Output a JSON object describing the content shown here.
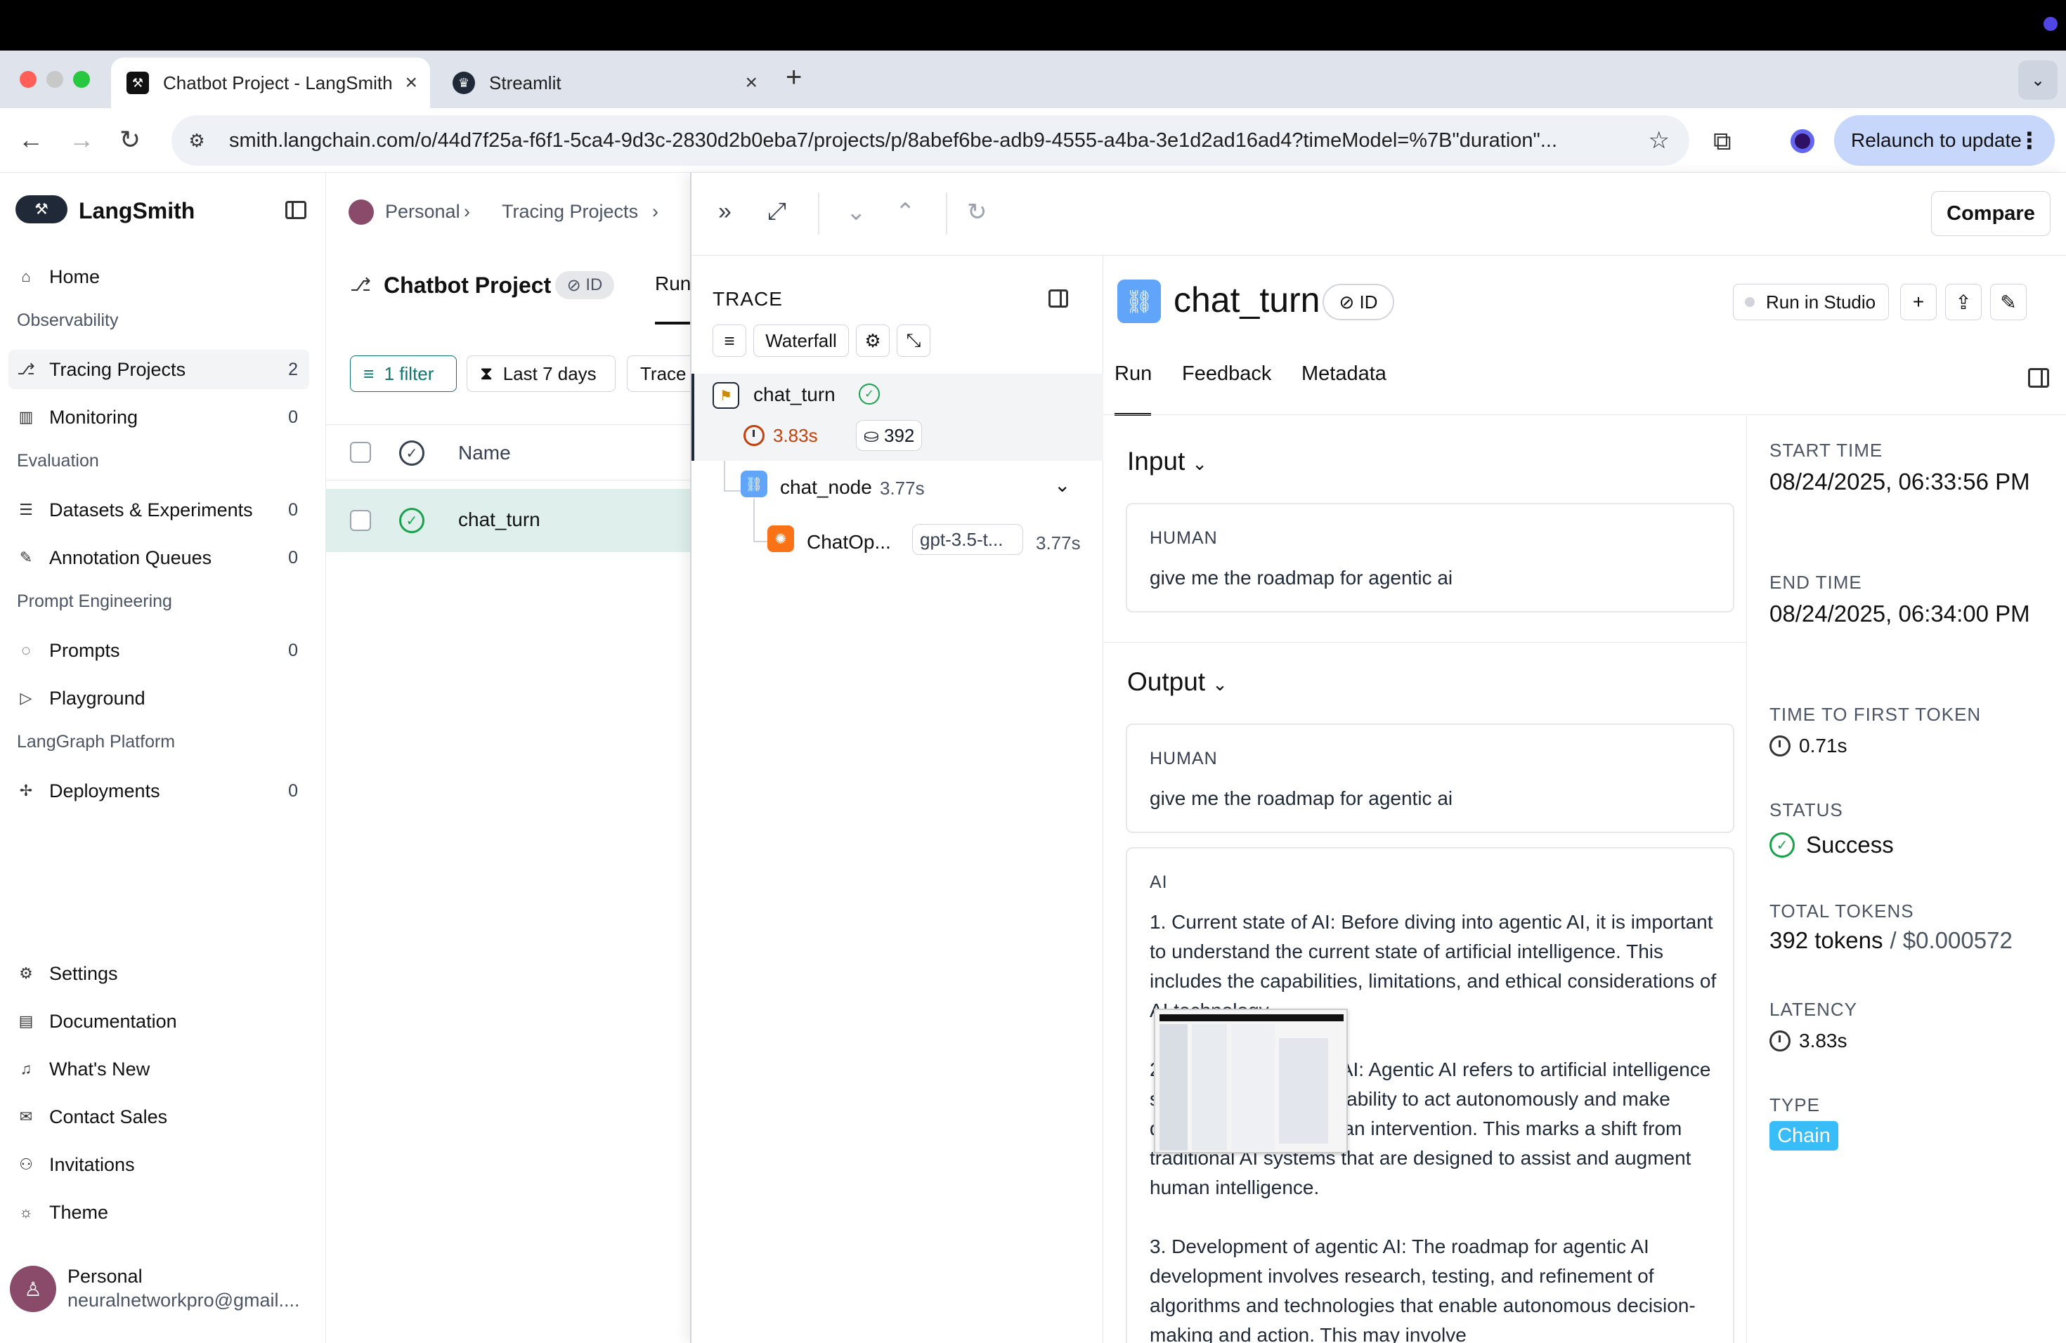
{
  "browser": {
    "tabs": [
      {
        "title": "Chatbot Project - LangSmith",
        "active": true
      },
      {
        "title": "Streamlit",
        "active": false
      }
    ],
    "url": "smith.langchain.com/o/44d7f25a-f6f1-5ca4-9d3c-2830d2b0eba7/projects/p/8abef6be-adb9-4555-a4ba-3e1d2ad16ad4?timeModel=%7B\"duration\"...",
    "relaunch_label": "Relaunch to update"
  },
  "sidebar": {
    "brand": "LangSmith",
    "home": "Home",
    "sections": {
      "observability": "Observability",
      "evaluation": "Evaluation",
      "prompt_engineering": "Prompt Engineering",
      "langgraph": "LangGraph Platform"
    },
    "items": {
      "tracing": {
        "label": "Tracing Projects",
        "count": "2"
      },
      "monitoring": {
        "label": "Monitoring",
        "count": "0"
      },
      "datasets": {
        "label": "Datasets & Experiments",
        "count": "0"
      },
      "annotation": {
        "label": "Annotation Queues",
        "count": "0"
      },
      "prompts": {
        "label": "Prompts",
        "count": "0"
      },
      "playground": {
        "label": "Playground"
      },
      "deployments": {
        "label": "Deployments",
        "count": "0"
      }
    },
    "bottom": {
      "settings": "Settings",
      "documentation": "Documentation",
      "whats_new": "What's New",
      "contact_sales": "Contact Sales",
      "invitations": "Invitations",
      "theme": "Theme"
    },
    "user": {
      "name": "Personal",
      "email": "neuralnetworkpro@gmail...."
    }
  },
  "project": {
    "breadcrumb": [
      "Personal",
      "Tracing Projects"
    ],
    "title": "Chatbot Project",
    "id_label": "ID",
    "tab": "Run",
    "filter_label": "1 filter",
    "date_label": "Last 7 days",
    "trace_label": "Trace",
    "column_name": "Name",
    "row_name": "chat_turn"
  },
  "drawer": {
    "compare_label": "Compare",
    "trace": {
      "title": "TRACE",
      "waterfall_label": "Waterfall",
      "root": {
        "name": "chat_turn",
        "latency": "3.83s",
        "tokens": "392"
      },
      "child": {
        "name": "chat_node",
        "latency": "3.77s"
      },
      "leaf": {
        "name": "ChatOp...",
        "model": "gpt-3.5-t...",
        "latency": "3.77s"
      }
    },
    "detail": {
      "title": "chat_turn",
      "id_label": "ID",
      "run_in_studio": "Run in Studio",
      "tabs": [
        "Run",
        "Feedback",
        "Metadata"
      ],
      "input": {
        "heading": "Input",
        "role": "HUMAN",
        "text": "give me the roadmap for agentic ai"
      },
      "output": {
        "heading": "Output",
        "human_role": "HUMAN",
        "human_text": "give me the roadmap for agentic ai",
        "ai_role": "AI",
        "ai_paragraphs": [
          "1. Current state of AI: Before diving into agentic AI, it is important to understand the current state of artificial intelligence. This includes the capabilities, limitations, and ethical considerations of AI technology.",
          "2. Concept of agentic AI: Agentic AI refers to artificial intelligence systems that have the ability to act autonomously and make decisions without human intervention. This marks a shift from traditional AI systems that are designed to assist and augment human intelligence.",
          "3. Development of agentic AI: The roadmap for agentic AI development involves research, testing, and refinement of algorithms and technologies that enable autonomous decision-making and action. This may involve"
        ]
      },
      "meta": {
        "start_time_label": "START TIME",
        "start_time": "08/24/2025, 06:33:56 PM",
        "end_time_label": "END TIME",
        "end_time": "08/24/2025, 06:34:00 PM",
        "ttft_label": "TIME TO FIRST TOKEN",
        "ttft": "0.71s",
        "status_label": "STATUS",
        "status": "Success",
        "tokens_label": "TOTAL TOKENS",
        "tokens": "392 tokens",
        "cost": "/ $0.000572",
        "latency_label": "LATENCY",
        "latency": "3.83s",
        "type_label": "TYPE",
        "type": "Chain"
      }
    }
  },
  "colors": {
    "selected_row": "#dff0ec",
    "success": "#16a34a",
    "chain_badge": "#38bdf8",
    "latency_accent": "#c2410c"
  }
}
